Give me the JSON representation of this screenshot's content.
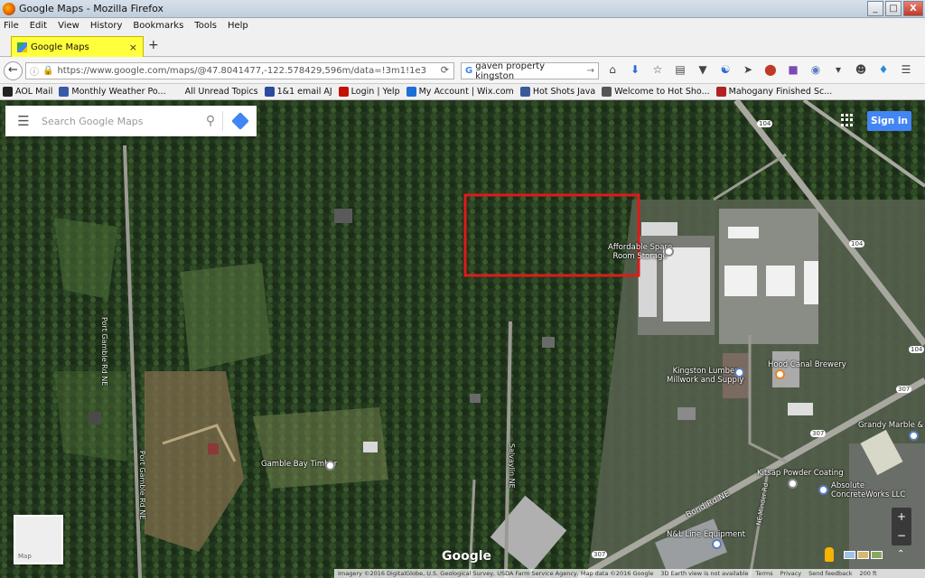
{
  "window": {
    "title": "Google Maps - Mozilla Firefox",
    "controls": [
      "_",
      "□",
      "X"
    ]
  },
  "menu": [
    "File",
    "Edit",
    "View",
    "History",
    "Bookmarks",
    "Tools",
    "Help"
  ],
  "tab": {
    "label": "Google Maps",
    "close": "×",
    "new_tab": "+"
  },
  "nav": {
    "url": "https://www.google.com/maps/@47.8041477,-122.578429,596m/data=!3m1!1e3",
    "search_value": "gaven property kingston"
  },
  "bookmarks": [
    {
      "label": "AOL Mail",
      "color": "#222222"
    },
    {
      "label": "Monthly Weather Po...",
      "color": "#3a5aa8"
    },
    {
      "label": "All Unread Topics",
      "color": ""
    },
    {
      "label": "1&1 email AJ",
      "color": "#2b4aa0"
    },
    {
      "label": "Login | Yelp",
      "color": "#c41200"
    },
    {
      "label": "My Account | Wix.com",
      "color": "#1b6fd6"
    },
    {
      "label": "Hot Shots Java",
      "color": "#3b5998"
    },
    {
      "label": "Welcome to Hot Sho...",
      "color": "#555555"
    },
    {
      "label": "Mahogany Finished Sc...",
      "color": "#b22222"
    }
  ],
  "map": {
    "search_placeholder": "Search Google Maps",
    "sign_in": "Sign in",
    "minimap_label": "Map",
    "logo": "Google",
    "highlight_color": "#e01a1a",
    "places": [
      {
        "name": "Affordable Spare",
        "line2": "Room Storage"
      },
      {
        "name": "Kingston Lumber",
        "line2": "Millwork and Supply"
      },
      {
        "name": "Hood Canal Brewery"
      },
      {
        "name": "Gamble Bay Timber"
      },
      {
        "name": "Grandy Marble & Tile"
      },
      {
        "name": "Kitsap Powder Coating"
      },
      {
        "name": "Absolute",
        "line2": "ConcreteWorks LLC"
      },
      {
        "name": "N&L Line Equipment"
      }
    ],
    "roads": [
      "Port Gamble Rd NE",
      "Port Gamble Rd NE",
      "Salvaylin NE",
      "Bond Rd NE",
      "NE Minder Rd",
      "Bond Rd NE"
    ],
    "route_shields": [
      "104",
      "104",
      "104",
      "307",
      "307",
      "307"
    ],
    "footer": [
      "Imagery ©2016 DigitalGlobe, U.S. Geological Survey, USDA Farm Service Agency, Map data ©2016 Google",
      "3D Earth view is not available",
      "Terms",
      "Privacy",
      "Send feedback",
      "200 ft"
    ]
  }
}
